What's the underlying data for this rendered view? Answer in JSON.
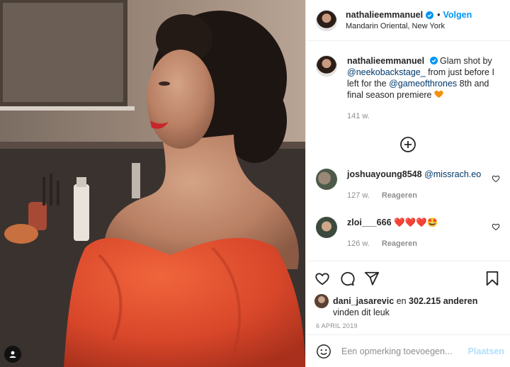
{
  "post": {
    "username": "nathalieemmanuel",
    "follow_label": "Volgen",
    "location": "Mandarin Oriental, New York"
  },
  "caption": {
    "username": "nathalieemmanuel",
    "text_1": "Glam shot by",
    "mention_1": "@neekobackstage_",
    "text_2": "from just before I left for the",
    "mention_2": "@gameofthrones",
    "text_3": "8th and final season premiere",
    "age": "141 w."
  },
  "load_more_icon": "plus-circle-icon",
  "comments": [
    {
      "username": "joshuayoung8548",
      "text": "@missrach.eo",
      "age": "127 w.",
      "reply_label": "Reageren"
    },
    {
      "username": "zloi___666",
      "text": "❤️❤️❤️🤩",
      "age": "126 w.",
      "reply_label": "Reageren"
    }
  ],
  "likes": {
    "user": "dani_jasarevic",
    "connector": "en",
    "count": "302.215 anderen",
    "suffix": "vinden dit leuk"
  },
  "date": "6 APRIL 2019",
  "add_comment": {
    "placeholder": "Een opmerking toevoegen...",
    "post_label": "Plaatsen"
  },
  "colors": {
    "accent": "#0095f6",
    "mention": "#00376b",
    "post_disabled": "#b2dffc",
    "dress": "#e0512f"
  },
  "icons": [
    "verified-badge-icon",
    "heart-icon",
    "comment-icon",
    "share-icon",
    "bookmark-icon",
    "emoji-icon",
    "user-tag-icon"
  ]
}
